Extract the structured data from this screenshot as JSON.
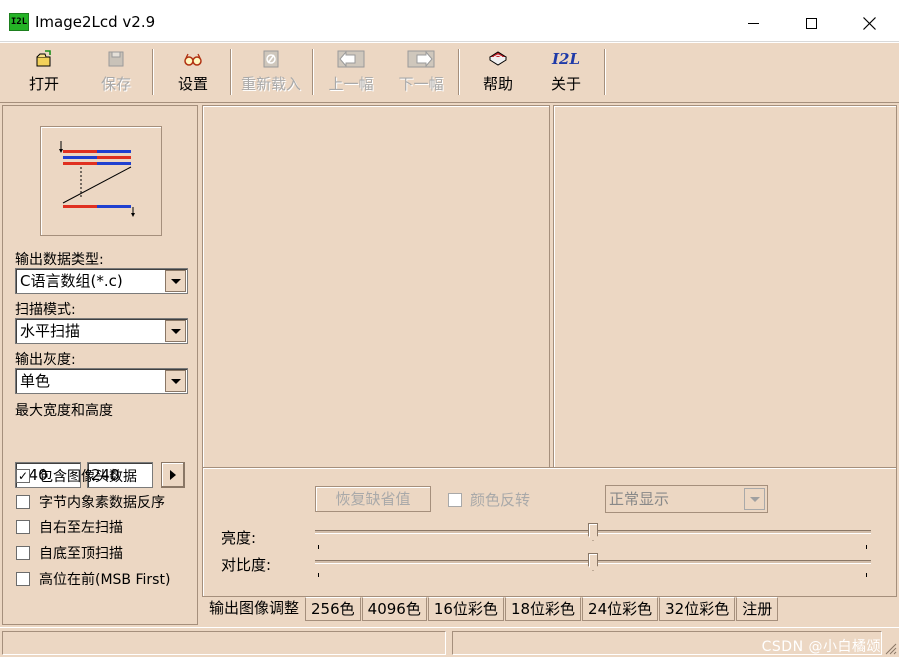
{
  "window": {
    "title": "Image2Lcd v2.9",
    "icon_text": "I2L"
  },
  "toolbar": {
    "open": "打开",
    "save": "保存",
    "settings": "设置",
    "reload": "重新载入",
    "prev": "上一幅",
    "next": "下一幅",
    "help": "帮助",
    "about": "关于",
    "about_icon_text": "I2L"
  },
  "left": {
    "output_type_label": "输出数据类型:",
    "output_type_value": "C语言数组(*.c)",
    "scan_mode_label": "扫描模式:",
    "scan_mode_value": "水平扫描",
    "gray_label": "输出灰度:",
    "gray_value": "单色",
    "max_size_label": "最大宽度和高度",
    "width_value": "240",
    "height_value": "240",
    "checks": [
      {
        "label": "包含图像头数据",
        "checked": true
      },
      {
        "label": "字节内象素数据反序",
        "checked": false
      },
      {
        "label": "自右至左扫描",
        "checked": false
      },
      {
        "label": "自底至顶扫描",
        "checked": false
      },
      {
        "label": "高位在前(MSB First)",
        "checked": false
      }
    ]
  },
  "adjust": {
    "restore_label": "恢复缺省值",
    "invert_label": "颜色反转",
    "display_value": "正常显示",
    "brightness_label": "亮度:",
    "contrast_label": "对比度:",
    "brightness_level": 0.5,
    "contrast_level": 0.5
  },
  "tabs": [
    "输出图像调整",
    "256色",
    "4096色",
    "16位彩色",
    "18位彩色",
    "24位彩色",
    "32位彩色",
    "注册"
  ],
  "watermark": "CSDN @小白橘颂",
  "colors": {
    "background": "#ecd7c3",
    "border": "#a58f7c",
    "disabled_text": "#a9a9a9",
    "scan_red": "#e03020",
    "scan_blue": "#2040d0"
  }
}
